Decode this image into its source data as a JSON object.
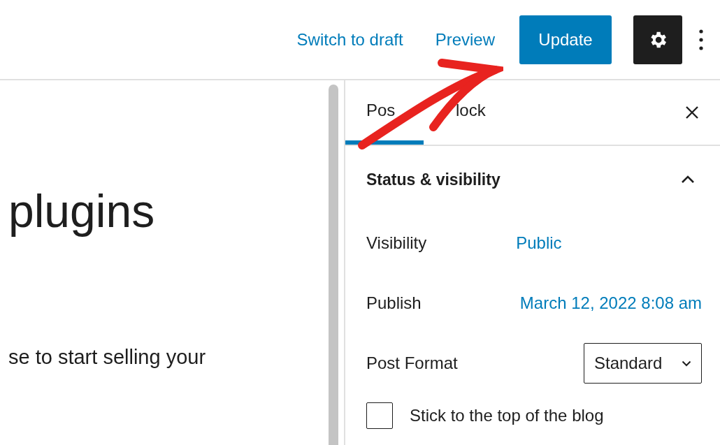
{
  "header": {
    "links": [
      "Switch to draft",
      "Preview"
    ],
    "primary_button": "Update"
  },
  "editor": {
    "title": "plugins",
    "paragraph": "se to start selling your"
  },
  "sidebar": {
    "tabs": [
      {
        "label": "Pos",
        "selected": true
      },
      {
        "label": "lock",
        "selected": false
      }
    ],
    "panel": {
      "title": "Status & visibility",
      "expanded": true,
      "rows": [
        {
          "kind": "link",
          "label": "Visibility",
          "value": "Public"
        },
        {
          "kind": "link",
          "label": "Publish",
          "value": "March 12, 2022 8:08 am"
        },
        {
          "kind": "select",
          "label": "Post Format",
          "value": "Standard"
        },
        {
          "kind": "checkbox",
          "label": "Stick to the top of the blog",
          "checked": false
        }
      ]
    }
  }
}
